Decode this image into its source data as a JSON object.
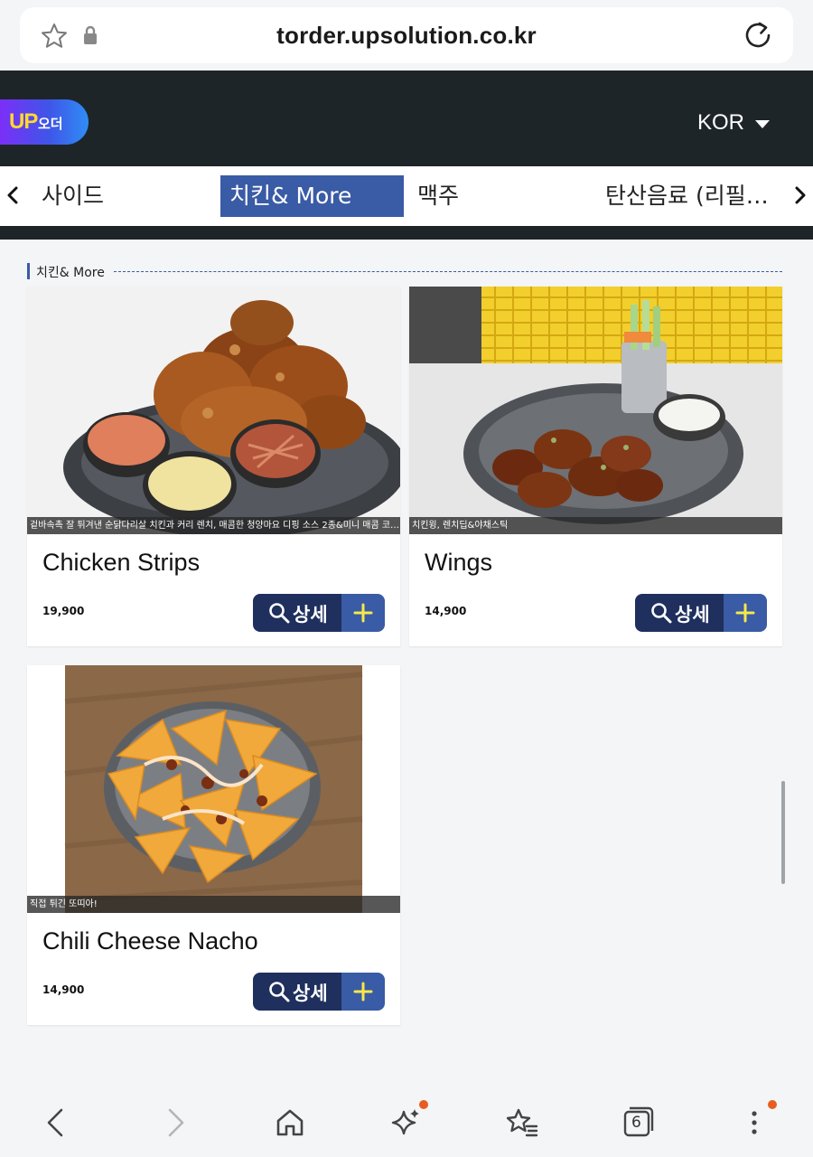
{
  "browser": {
    "url": "torder.upsolution.co.kr",
    "tab_count": "6",
    "icons": [
      "star-icon",
      "lock-icon",
      "reload-icon",
      "back-icon",
      "forward-icon",
      "home-icon",
      "sparkle-icon",
      "bookmarks-icon",
      "tabs-icon",
      "more-icon"
    ],
    "badge_color": "#e85d1f"
  },
  "header": {
    "logo_up": "UP",
    "logo_order": "오더",
    "language": "KOR"
  },
  "categories": {
    "items": [
      "사이드",
      "치킨& More",
      "맥주",
      "탄산음료 (리필…"
    ],
    "active": "치킨& More"
  },
  "section": {
    "title": "치킨& More"
  },
  "menu": [
    {
      "name": "Chicken Strips",
      "description": "겉바속촉 잘 튀겨낸 순닭다리살 치킨과 커리 렌치, 매콤한 청양마요 디핑 소스 2종&미니 매콤 코…",
      "price": "19,900",
      "detail_label": "상세"
    },
    {
      "name": "Wings",
      "description": "치킨윙, 렌치딥&야채스틱",
      "price": "14,900",
      "detail_label": "상세"
    },
    {
      "name": "Chili Cheese Nacho",
      "description": "직접 튀긴 또띠아!",
      "price": "14,900",
      "detail_label": "상세"
    }
  ],
  "colors": {
    "header_bg": "#1e2529",
    "accent": "#3a5ba5",
    "detail_button": "#1f2f5e",
    "add_icon": "#f5e94a"
  }
}
